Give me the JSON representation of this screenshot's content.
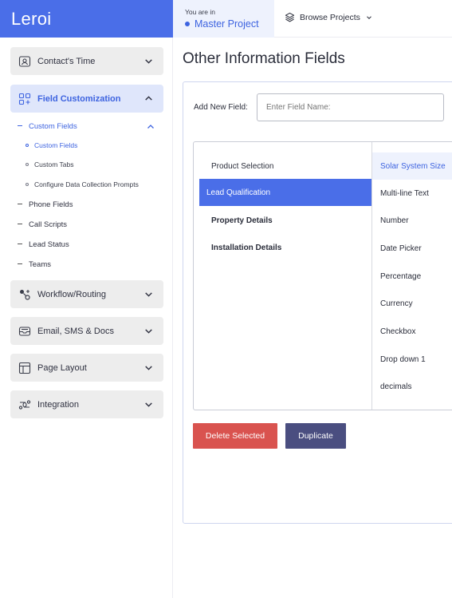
{
  "app": {
    "brand": "Leroi"
  },
  "topbar": {
    "you_are_in": "You are in",
    "project": "Master Project",
    "browse": "Browse Projects"
  },
  "sidebar": {
    "contacts_time": "Contact's Time",
    "field_customization": "Field Customization",
    "custom_fields_group": "Custom Fields",
    "sub_custom_fields": "Custom Fields",
    "sub_custom_tabs": "Custom Tabs",
    "sub_configure": "Configure Data Collection Prompts",
    "phone_fields": "Phone Fields",
    "call_scripts": "Call Scripts",
    "lead_status": "Lead Status",
    "teams": "Teams",
    "workflow": "Workflow/Routing",
    "email_sms": "Email, SMS & Docs",
    "page_layout": "Page Layout",
    "integration": "Integration"
  },
  "main": {
    "title": "Other Information Fields",
    "add_label": "Add New Field:",
    "add_placeholder": "Enter Field Name:",
    "sections": [
      "Product Selection",
      "Lead Qualification",
      "Property Details",
      "Installation Details"
    ],
    "fields": [
      "Solar System Size",
      "Multi-line Text",
      "Number",
      "Date Picker",
      "Percentage",
      "Currency",
      "Checkbox",
      "Drop down 1",
      "decimals"
    ],
    "delete_button": "Delete Selected",
    "duplicate_button": "Duplicate"
  },
  "colors": {
    "brand_blue": "#4a6ee8",
    "delete_red": "#d9534f",
    "duplicate_navy": "#4a4e80"
  }
}
